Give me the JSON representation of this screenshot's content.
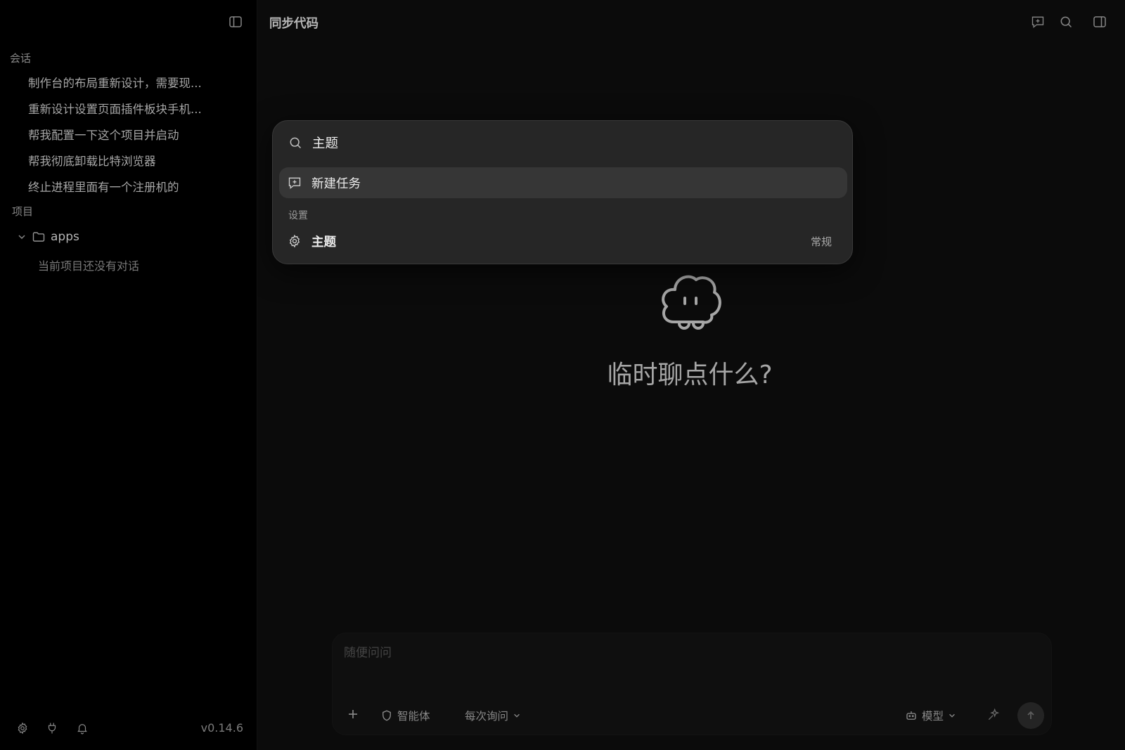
{
  "app": {
    "title": "同步代码",
    "version": "v0.14.6"
  },
  "sidebar": {
    "conversations_label": "会话",
    "conversations": [
      {
        "title": "制作台的布局重新设计，需要现..."
      },
      {
        "title": "重新设计设置页面插件板块手机..."
      },
      {
        "title": "帮我配置一下这个项目并启动"
      },
      {
        "title": "帮我彻底卸载比特浏览器"
      },
      {
        "title": "终止进程里面有一个注册机的"
      }
    ],
    "projects_label": "项目",
    "project": {
      "name": "apps",
      "empty_text": "当前项目还没有对话"
    },
    "footer_icons": [
      "gear-icon",
      "plug-icon",
      "bell-icon"
    ]
  },
  "main": {
    "hero_text": "临时聊点什么?",
    "composer": {
      "placeholder": "随便问问",
      "agent_label": "智能体",
      "ask_mode_label": "每次询问",
      "model_label": "模型"
    }
  },
  "palette": {
    "query": "主题",
    "first_item": {
      "label": "新建任务",
      "icon": "new-task-icon"
    },
    "group_label": "设置",
    "result": {
      "label": "主题",
      "hint": "常规",
      "icon": "gear-icon"
    }
  }
}
